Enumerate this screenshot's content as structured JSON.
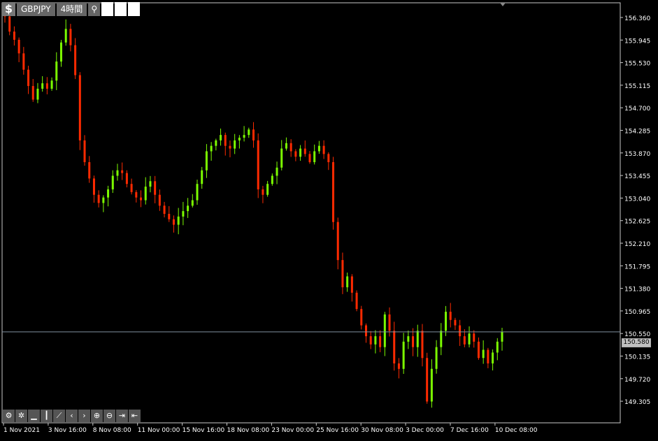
{
  "toolbar": {
    "symbol_icon": "$",
    "symbol": "GBPJPY",
    "timeframe": "4時間",
    "pin_icon": "pin-icon"
  },
  "current_price": "150.580",
  "colors": {
    "background": "#000000",
    "bull": "#7CFC00",
    "bear": "#FF2A00",
    "axis": "#C8C8C8",
    "price_line": "#8090A0"
  },
  "bottom_toolbar": [
    {
      "name": "settings-icon",
      "glyph": "⚙"
    },
    {
      "name": "gear-icon",
      "glyph": "✲"
    },
    {
      "name": "bar-chart-icon",
      "glyph": "▁"
    },
    {
      "name": "candle-icon",
      "glyph": "┃"
    },
    {
      "name": "line-chart-icon",
      "glyph": "⟋"
    },
    {
      "name": "scroll-left-icon",
      "glyph": "‹"
    },
    {
      "name": "scroll-right-icon",
      "glyph": "›"
    },
    {
      "name": "zoom-in-icon",
      "glyph": "⊕"
    },
    {
      "name": "zoom-out-icon",
      "glyph": "⊖"
    },
    {
      "name": "autoscroll-icon",
      "glyph": "⇥"
    },
    {
      "name": "chart-shift-icon",
      "glyph": "⇤"
    }
  ],
  "chart_data": {
    "type": "candlestick",
    "symbol": "GBPJPY",
    "timeframe": "4時間",
    "y_ticks": [
      "156.360",
      "155.945",
      "155.530",
      "155.115",
      "154.700",
      "154.285",
      "153.870",
      "153.455",
      "153.040",
      "152.625",
      "152.210",
      "151.795",
      "151.380",
      "150.965",
      "150.550",
      "150.135",
      "149.720",
      "149.305"
    ],
    "x_ticks": [
      "1 Nov 2021",
      "3 Nov 16:00",
      "8 Nov 08:00",
      "11 Nov 00:00",
      "15 Nov 16:00",
      "18 Nov 08:00",
      "23 Nov 00:00",
      "25 Nov 16:00",
      "30 Nov 08:00",
      "3 Dec 00:00",
      "7 Dec 16:00",
      "10 Dec 08:00"
    ],
    "ylim": [
      149.0,
      156.6
    ],
    "closes": [
      156.38,
      156.1,
      155.95,
      155.7,
      155.4,
      155.1,
      154.85,
      155.05,
      155.15,
      155.05,
      155.2,
      155.55,
      155.9,
      156.15,
      155.85,
      155.3,
      154.1,
      153.7,
      153.4,
      153.1,
      152.95,
      153.05,
      153.2,
      153.45,
      153.55,
      153.5,
      153.3,
      153.15,
      153.05,
      153.0,
      153.25,
      153.35,
      153.1,
      152.9,
      152.75,
      152.65,
      152.55,
      152.7,
      152.8,
      152.9,
      153.0,
      153.3,
      153.55,
      153.9,
      154.0,
      154.1,
      154.2,
      154.0,
      153.95,
      154.1,
      154.15,
      154.2,
      154.3,
      154.1,
      153.2,
      153.1,
      153.3,
      153.45,
      153.6,
      153.95,
      154.05,
      153.9,
      153.8,
      153.95,
      153.85,
      153.7,
      153.9,
      154.0,
      153.85,
      153.7,
      152.6,
      151.9,
      151.4,
      151.6,
      151.3,
      151.0,
      150.7,
      150.5,
      150.35,
      150.5,
      150.3,
      150.9,
      150.6,
      150.0,
      149.9,
      150.4,
      150.5,
      150.3,
      150.6,
      150.1,
      149.3,
      149.9,
      150.3,
      150.6,
      150.95,
      150.8,
      150.7,
      150.5,
      150.35,
      150.55,
      150.4,
      150.1,
      150.25,
      150.0,
      150.2,
      150.4,
      150.58
    ],
    "note_count": 107
  }
}
